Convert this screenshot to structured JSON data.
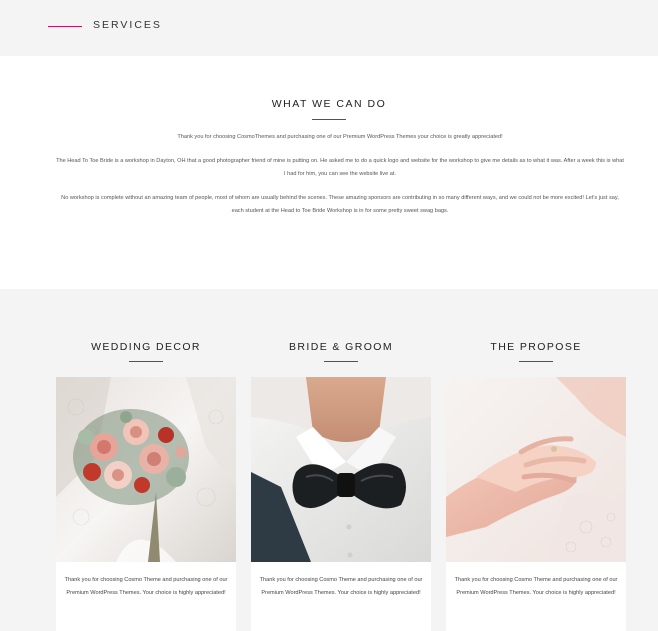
{
  "topbar": {
    "title": "SERVICES"
  },
  "intro": {
    "heading": "WHAT WE CAN DO",
    "paragraphs": [
      "Thank you for choosing CosmoThemes and purchasing one of our Premium WordPress Themes your choice is greatly appreciated!",
      "The Head To Toe Bride is a workshop in Dayton, OH that a good photographer friend of mine is putting on. He asked me to do a quick logo and website for the workshop to give me details as to what it was. After a week this is what I had for him, you can see the website live at.",
      "No workshop is complete without an amazing team of people, most of whom are usually behind the scenes. These amazing sponsors are contributing in so many different ways, and we could not be more excited! Let's just say, each student at the Head to Toe Bride Workshop is in for some pretty sweet swag bags."
    ]
  },
  "services": [
    {
      "title": "WEDDING DECOR",
      "description": "Thank you for choosing Cosmo Theme and purchasing one of our Premium WordPress Themes. Your choice is highly appreciated!"
    },
    {
      "title": "BRIDE & GROOM",
      "description": "Thank you for choosing Cosmo Theme and purchasing one of our Premium WordPress Themes. Your choice is highly appreciated!"
    },
    {
      "title": "THE PROPOSE",
      "description": "Thank you for choosing Cosmo Theme and purchasing one of our Premium WordPress Themes. Your choice is highly appreciated!"
    }
  ],
  "colors": {
    "accent": "#c2185b",
    "page_background": "#f4f4f4",
    "panel_background": "#ffffff"
  }
}
